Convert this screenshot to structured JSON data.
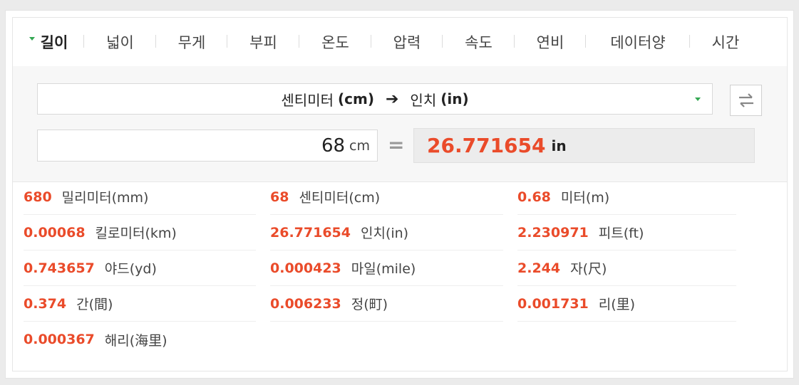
{
  "tabs": [
    {
      "label": "길이",
      "active": true
    },
    {
      "label": "넓이",
      "active": false
    },
    {
      "label": "무게",
      "active": false
    },
    {
      "label": "부피",
      "active": false
    },
    {
      "label": "온도",
      "active": false
    },
    {
      "label": "압력",
      "active": false
    },
    {
      "label": "속도",
      "active": false
    },
    {
      "label": "연비",
      "active": false
    },
    {
      "label": "데이터양",
      "active": false
    },
    {
      "label": "시간",
      "active": false
    }
  ],
  "converter": {
    "from_label": "센티미터",
    "from_unit": "(cm)",
    "arrow": "➔",
    "to_label": "인치",
    "to_unit": "(in)",
    "input_value": "68",
    "input_unit": "cm",
    "equals": "=",
    "result_value": "26.771654",
    "result_unit": "in"
  },
  "results": [
    {
      "num": "680",
      "label": "밀리미터(mm)"
    },
    {
      "num": "68",
      "label": "센티미터(cm)"
    },
    {
      "num": "0.68",
      "label": "미터(m)"
    },
    {
      "num": "0.00068",
      "label": "킬로미터(km)"
    },
    {
      "num": "26.771654",
      "label": "인치(in)"
    },
    {
      "num": "2.230971",
      "label": "피트(ft)"
    },
    {
      "num": "0.743657",
      "label": "야드(yd)"
    },
    {
      "num": "0.000423",
      "label": "마일(mile)"
    },
    {
      "num": "2.244",
      "label": "자(尺)"
    },
    {
      "num": "0.374",
      "label": "간(間)"
    },
    {
      "num": "0.006233",
      "label": "정(町)"
    },
    {
      "num": "0.001731",
      "label": "리(里)"
    },
    {
      "num": "0.000367",
      "label": "해리(海里)"
    }
  ],
  "colors": {
    "accent": "#ea4b2a",
    "active_arrow": "#34a853"
  }
}
